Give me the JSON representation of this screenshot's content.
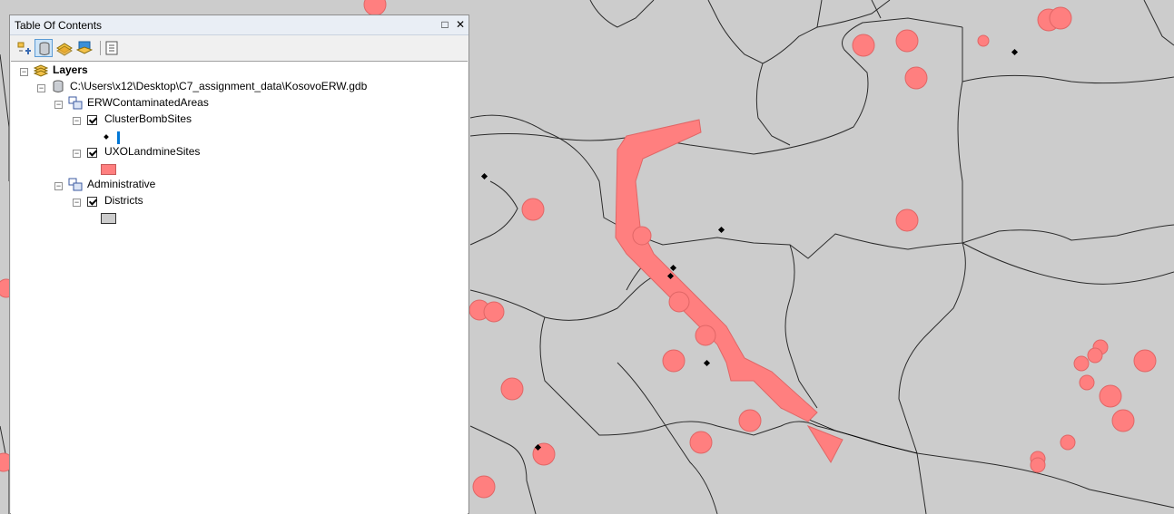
{
  "toc": {
    "title": "Table Of Contents",
    "pin_glyph": "□",
    "close_glyph": "✕",
    "toolbar": {
      "tools": [
        {
          "name": "list-by-drawing-order-icon"
        },
        {
          "name": "list-by-source-icon",
          "pressed": true
        },
        {
          "name": "list-by-visibility-icon"
        },
        {
          "name": "list-by-selection-icon"
        },
        {
          "name": "options-icon"
        }
      ]
    },
    "tree": {
      "root_label": "Layers",
      "database_label": "C:\\Users\\x12\\Desktop\\C7_assignment_data\\KosovoERW.gdb",
      "group1_label": "ERWContaminatedAreas",
      "layer1_label": "ClusterBombSites",
      "layer2_label": "UXOLandmineSites",
      "group2_label": "Administrative",
      "layer3_label": "Districts",
      "expander_glyph": "−"
    }
  },
  "colors": {
    "map_background": "#cccccc",
    "district_fill": "#cccccc",
    "district_border": "#2b2b2b",
    "uxo_fill": "#ff7f7f",
    "uxo_outline": "#e06666",
    "cluster_point": "#000000",
    "selection_bar": "#0078d7"
  }
}
